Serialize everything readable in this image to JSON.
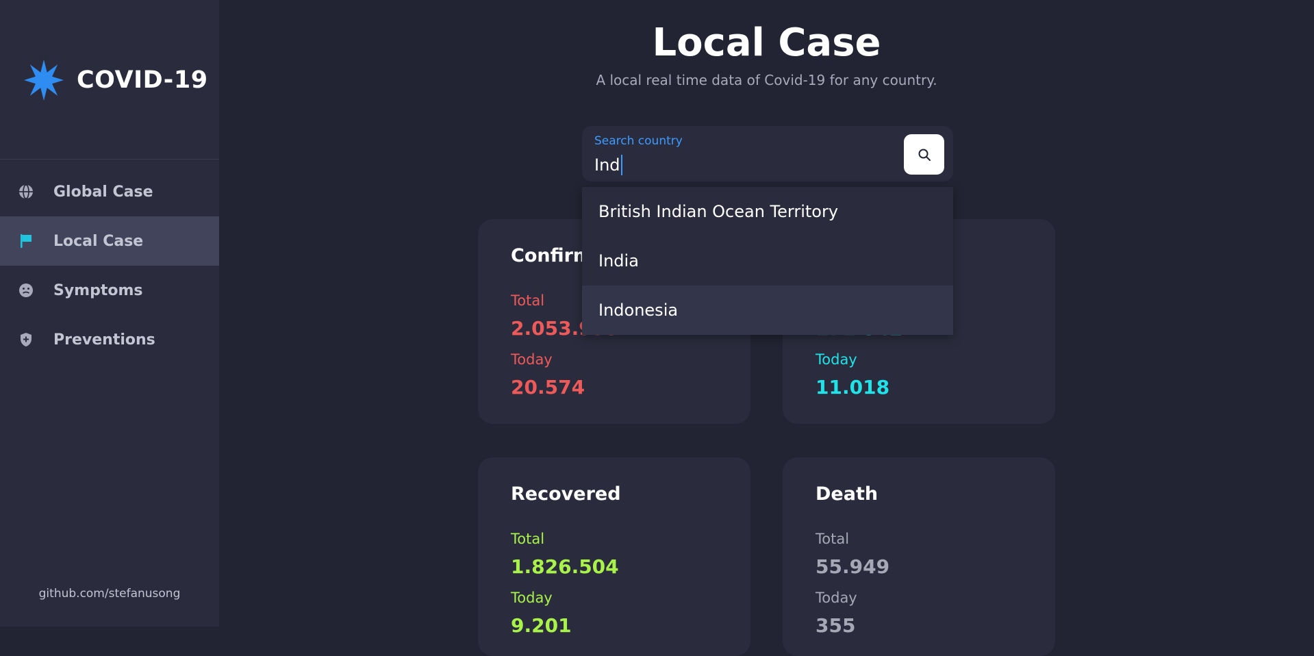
{
  "sidebar": {
    "brand": "COVID-19",
    "items": [
      {
        "label": "Global Case",
        "icon": "globe-icon"
      },
      {
        "label": "Local Case",
        "icon": "flag-icon"
      },
      {
        "label": "Symptoms",
        "icon": "sick-face-icon"
      },
      {
        "label": "Preventions",
        "icon": "shield-plus-icon"
      }
    ],
    "footer_link": "github.com/stefanusong"
  },
  "header": {
    "title": "Local Case",
    "subtitle": "A local real time data of Covid-19 for any country."
  },
  "search": {
    "label": "Search country",
    "value": "Ind",
    "options": [
      "British Indian Ocean Territory",
      "India",
      "Indonesia"
    ],
    "highlighted_option": "Indonesia"
  },
  "cards": {
    "confirmed": {
      "title": "Confirmed",
      "total_label": "Total",
      "total": "2.053.995",
      "today_label": "Today",
      "today": "20.574",
      "color": "#ee5a5a"
    },
    "active": {
      "total": "171.542",
      "today_label": "Today",
      "today": "11.018",
      "color": "#20e3e9"
    },
    "recovered": {
      "title": "Recovered",
      "total_label": "Total",
      "total": "1.826.504",
      "today_label": "Today",
      "today": "9.201",
      "color": "#a8f24a"
    },
    "death": {
      "title": "Death",
      "total_label": "Total",
      "total": "55.949",
      "today_label": "Today",
      "today": "355",
      "color": "#a6a8b6"
    }
  },
  "colors": {
    "background": "#222433",
    "panel": "#2a2c3d",
    "accent": "#3d9bff",
    "nav_active": "#41445a",
    "virus_logo": "#2f8cf0"
  }
}
